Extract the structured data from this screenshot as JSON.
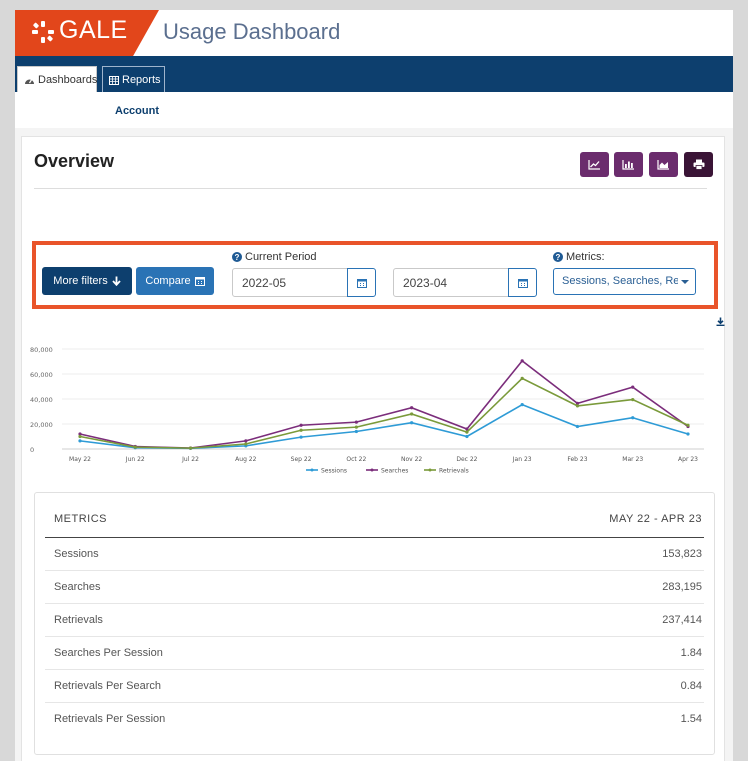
{
  "brand": {
    "logo_text": "GALE",
    "app_title": "Usage Dashboard",
    "accent": "#e2461b",
    "nav_color": "#0d3f6e",
    "purple": "#6b2c6d"
  },
  "nav": {
    "tabs": [
      {
        "label": "Dashboards",
        "icon": "dashboard-icon",
        "active": true
      },
      {
        "label": "Reports",
        "icon": "table-icon",
        "active": false
      }
    ],
    "subnav": [
      "Account"
    ]
  },
  "overview": {
    "title": "Overview",
    "toolbar": [
      "line-chart-icon",
      "bar-chart-icon",
      "area-chart-icon",
      "print-icon"
    ]
  },
  "filters": {
    "more_filters_label": "More filters",
    "compare_label": "Compare",
    "current_period_label": "Current Period",
    "start_date": "2022-05",
    "end_date": "2023-04",
    "metrics_label": "Metrics:",
    "metrics_value": "Sessions, Searches, Re"
  },
  "chart_data": {
    "type": "line",
    "categories": [
      "May 22",
      "Jun 22",
      "Jul 22",
      "Aug 22",
      "Sep 22",
      "Oct 22",
      "Nov 22",
      "Dec 22",
      "Jan 23",
      "Feb 23",
      "Mar 23",
      "Apr 23"
    ],
    "yticks": [
      "80,000",
      "60,000",
      "40,000",
      "20,000",
      "0"
    ],
    "ylim": [
      0,
      80000
    ],
    "series": [
      {
        "name": "Sessions",
        "color": "#2e9bd6",
        "values": [
          6500,
          1000,
          500,
          2500,
          9500,
          14000,
          21000,
          10000,
          35500,
          18000,
          25000,
          12000
        ]
      },
      {
        "name": "Searches",
        "color": "#7b2d7b",
        "values": [
          12000,
          2000,
          800,
          6500,
          19000,
          21500,
          33000,
          16000,
          70500,
          36500,
          49500,
          18000
        ]
      },
      {
        "name": "Retrievals",
        "color": "#7a9a3a",
        "values": [
          10000,
          1500,
          700,
          4000,
          15000,
          17500,
          28000,
          13500,
          56500,
          34500,
          39500,
          19000
        ]
      }
    ],
    "grid": true,
    "legend": "bottom"
  },
  "metrics_table": {
    "header_left": "METRICS",
    "header_right": "MAY 22 - APR 23",
    "rows": [
      {
        "label": "Sessions",
        "value": "153,823"
      },
      {
        "label": "Searches",
        "value": "283,195"
      },
      {
        "label": "Retrievals",
        "value": "237,414"
      },
      {
        "label": "Searches Per Session",
        "value": "1.84"
      },
      {
        "label": "Retrievals Per Search",
        "value": "0.84"
      },
      {
        "label": "Retrievals Per Session",
        "value": "1.54"
      }
    ]
  }
}
